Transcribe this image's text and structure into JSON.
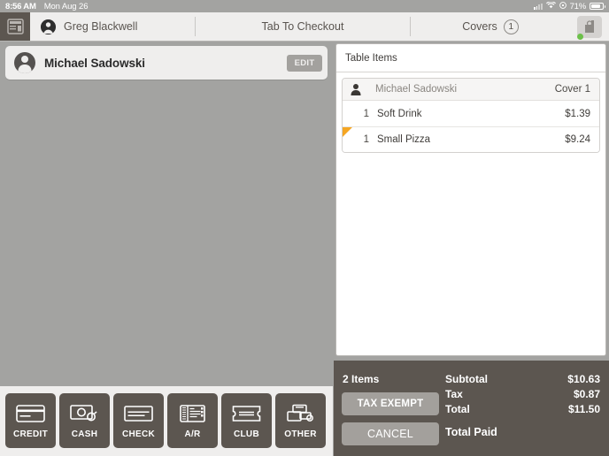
{
  "status_bar": {
    "time": "8:56 AM",
    "date": "Mon Aug 26",
    "battery_percent": "71%",
    "wifi_icon": "wifi-icon",
    "signal_icon": "cellular-signal-icon",
    "battery_icon": "battery-icon"
  },
  "navbar": {
    "app_icon": "register-icon",
    "user_name": "Greg Blackwell",
    "user_avatar_icon": "user-avatar-icon",
    "center_title": "Tab To Checkout",
    "covers_label": "Covers",
    "covers_count": "1",
    "lock_icon": "lock-icon",
    "status_dot_color": "#6cc04a"
  },
  "customer_card": {
    "avatar_icon": "customer-avatar-icon",
    "name": "Michael Sadowski",
    "edit_label": "EDIT"
  },
  "table_items": {
    "header": "Table Items",
    "cover": {
      "person_icon": "person-icon",
      "name": "Michael Sadowski",
      "cover_label": "Cover 1"
    },
    "rows": [
      {
        "qty": "1",
        "name": "Soft Drink",
        "price": "$1.39",
        "flagged": false
      },
      {
        "qty": "1",
        "name": "Small Pizza",
        "price": "$9.24",
        "flagged": true
      }
    ],
    "flag_color": "#f5a623"
  },
  "totals": {
    "items_count": "2 Items",
    "tax_exempt_label": "TAX EXEMPT",
    "cancel_label": "CANCEL",
    "subtotal_label": "Subtotal",
    "subtotal_value": "$10.63",
    "tax_label": "Tax",
    "tax_value": "$0.87",
    "total_label": "Total",
    "total_value": "$11.50",
    "total_paid_label": "Total Paid",
    "background_color": "#5c5650"
  },
  "payment_buttons": [
    {
      "label": "CREDIT",
      "icon": "credit-card-icon"
    },
    {
      "label": "CASH",
      "icon": "cash-icon"
    },
    {
      "label": "CHECK",
      "icon": "check-icon"
    },
    {
      "label": "A/R",
      "icon": "ar-ticket-icon"
    },
    {
      "label": "CLUB",
      "icon": "club-ticket-icon"
    },
    {
      "label": "OTHER",
      "icon": "other-payments-icon"
    }
  ],
  "colors": {
    "workspace_gray": "#a3a3a1",
    "panel_light": "#efeeed",
    "dark_brown": "#5c5650",
    "accent_orange": "#f5a623",
    "online_green": "#6cc04a"
  }
}
